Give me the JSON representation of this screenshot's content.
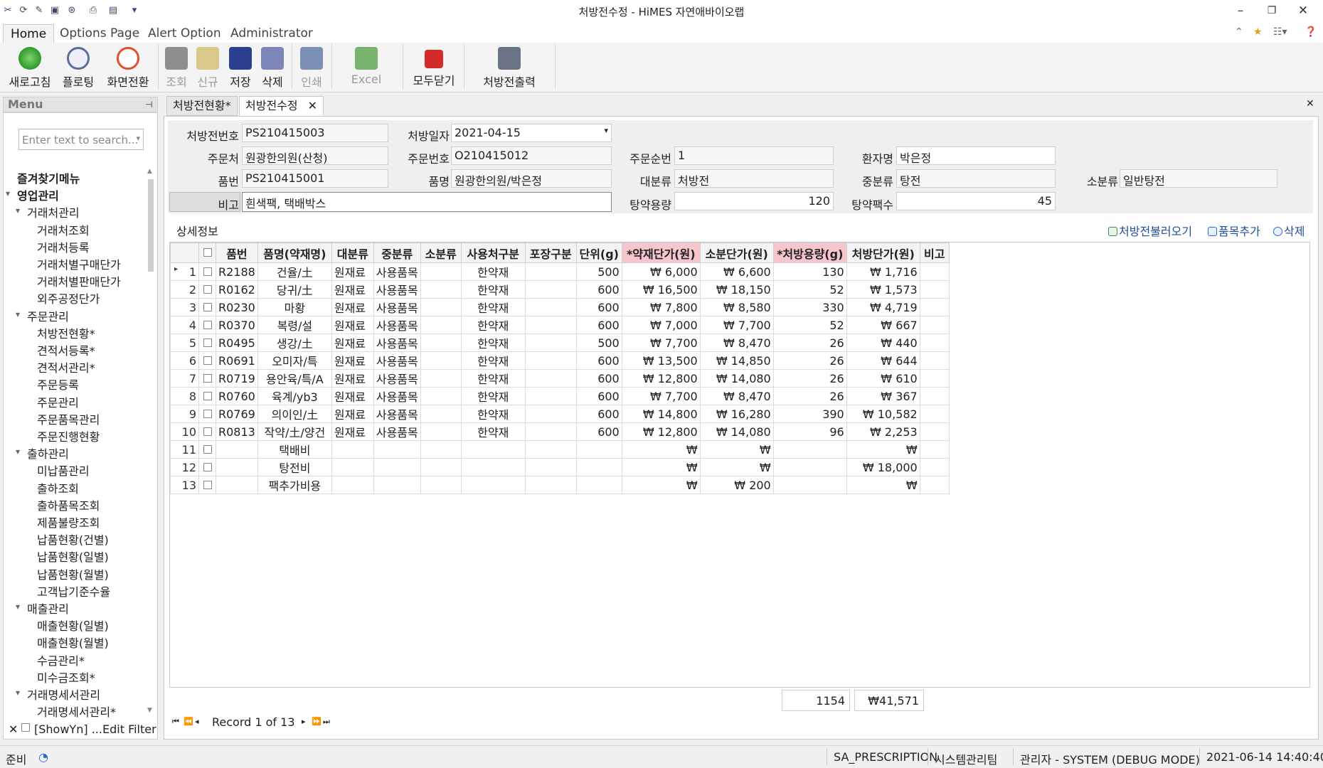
{
  "window": {
    "title": "처방전수정 - HiMES 자연애바이오랩",
    "controls": {
      "minimize": "–",
      "maximize": "❐",
      "close": "✕"
    }
  },
  "ribbon": {
    "tabs": [
      "Home",
      "Options Page",
      "Alert Option",
      "Administrator"
    ],
    "buttons": [
      {
        "label": "새로고침",
        "icon": "refresh-icon",
        "enabled": true
      },
      {
        "label": "플로팅",
        "icon": "floating-icon",
        "enabled": true
      },
      {
        "label": "화면전환",
        "icon": "clock-icon",
        "enabled": true
      },
      {
        "label": "조회",
        "icon": "search-icon",
        "enabled": false
      },
      {
        "label": "신규",
        "icon": "new-icon",
        "enabled": false
      },
      {
        "label": "저장",
        "icon": "save-icon",
        "enabled": true
      },
      {
        "label": "삭제",
        "icon": "delete-icon",
        "enabled": true
      },
      {
        "label": "인쇄",
        "icon": "print-icon",
        "enabled": false
      },
      {
        "label": "Excel",
        "icon": "excel-icon",
        "enabled": false
      },
      {
        "label": "모두닫기",
        "icon": "close-all-icon",
        "enabled": true
      },
      {
        "label": "처방전출력",
        "icon": "printer-icon",
        "enabled": true
      }
    ]
  },
  "menu": {
    "title": "Menu",
    "search_placeholder": "Enter text to search...",
    "items": [
      {
        "label": "즐겨찾기메뉴",
        "level": 0,
        "bold": true
      },
      {
        "label": "영업관리",
        "level": 0,
        "bold": true,
        "toggle": "▾"
      },
      {
        "label": "거래처관리",
        "level": 1,
        "toggle": "▾"
      },
      {
        "label": "거래처조회",
        "level": 2
      },
      {
        "label": "거래처등록",
        "level": 2
      },
      {
        "label": "거래처별구매단가",
        "level": 2
      },
      {
        "label": "거래처별판매단가",
        "level": 2
      },
      {
        "label": "외주공정단가",
        "level": 2
      },
      {
        "label": "주문관리",
        "level": 1,
        "toggle": "▾"
      },
      {
        "label": "처방전현황*",
        "level": 2
      },
      {
        "label": "견적서등록*",
        "level": 2
      },
      {
        "label": "견적서관리*",
        "level": 2
      },
      {
        "label": "주문등록",
        "level": 2
      },
      {
        "label": "주문관리",
        "level": 2
      },
      {
        "label": "주문품목관리",
        "level": 2
      },
      {
        "label": "주문진행현황",
        "level": 2
      },
      {
        "label": "출하관리",
        "level": 1,
        "toggle": "▾"
      },
      {
        "label": "미납품관리",
        "level": 2
      },
      {
        "label": "출하조회",
        "level": 2
      },
      {
        "label": "출하품목조회",
        "level": 2
      },
      {
        "label": "제품불량조회",
        "level": 2
      },
      {
        "label": "납품현황(건별)",
        "level": 2
      },
      {
        "label": "납품현황(일별)",
        "level": 2
      },
      {
        "label": "납품현황(월별)",
        "level": 2
      },
      {
        "label": "고객납기준수율",
        "level": 2
      },
      {
        "label": "매출관리",
        "level": 1,
        "toggle": "▾"
      },
      {
        "label": "매출현황(일별)",
        "level": 2
      },
      {
        "label": "매출현황(월별)",
        "level": 2
      },
      {
        "label": "수금관리*",
        "level": 2
      },
      {
        "label": "미수금조회*",
        "level": 2
      },
      {
        "label": "거래명세서관리",
        "level": 1,
        "toggle": "▾"
      },
      {
        "label": "거래명세서관리*",
        "level": 2
      }
    ],
    "footer": {
      "filter_text": "[ShowYn] ...",
      "edit_filter": "Edit Filter"
    }
  },
  "doc_tabs": [
    {
      "label": "처방전현황*",
      "active": false
    },
    {
      "label": "처방전수정",
      "active": true
    }
  ],
  "form": {
    "prescription_no": {
      "label": "처방전번호",
      "value": "PS210415003"
    },
    "prescription_date": {
      "label": "처방일자",
      "value": "2021-04-15"
    },
    "orderer": {
      "label": "주문처",
      "value": "원광한의원(산청)"
    },
    "order_no": {
      "label": "주문번호",
      "value": "O210415012"
    },
    "order_seq": {
      "label": "주문순번",
      "value": "1"
    },
    "patient": {
      "label": "환자명",
      "value": "박은정"
    },
    "item_no": {
      "label": "품번",
      "value": "PS210415001"
    },
    "item_name": {
      "label": "품명",
      "value": "원광한의원/박은정"
    },
    "major_class": {
      "label": "대분류",
      "value": "처방전"
    },
    "middle_class": {
      "label": "중분류",
      "value": "탕전"
    },
    "minor_class": {
      "label": "소분류",
      "value": "일반탕전"
    },
    "remark": {
      "label": "비고",
      "value": "흰색팩, 택배박스"
    },
    "decoction_volume": {
      "label": "탕약용량",
      "value": "120"
    },
    "pack_count": {
      "label": "탕약팩수",
      "value": "45"
    }
  },
  "detail": {
    "label": "상세정보",
    "actions": [
      "처방전불러오기",
      "품목추가",
      "삭제"
    ],
    "columns": [
      "품번",
      "품명(약재명)",
      "대분류",
      "중분류",
      "소분류",
      "사용처구분",
      "포장구분",
      "단위(g)",
      "*약재단가(원)",
      "소분단가(원)",
      "*처방용량(g)",
      "처방단가(원)",
      "비고"
    ],
    "rows": [
      [
        "1",
        "R2188",
        "건율/土",
        "원재료",
        "사용품목",
        "",
        "한약재",
        "",
        "500",
        "₩ 6,000",
        "₩ 6,600",
        "130",
        "₩ 1,716",
        ""
      ],
      [
        "2",
        "R0162",
        "당귀/土",
        "원재료",
        "사용품목",
        "",
        "한약재",
        "",
        "600",
        "₩ 16,500",
        "₩ 18,150",
        "52",
        "₩ 1,573",
        ""
      ],
      [
        "3",
        "R0230",
        "마황",
        "원재료",
        "사용품목",
        "",
        "한약재",
        "",
        "600",
        "₩ 7,800",
        "₩ 8,580",
        "330",
        "₩ 4,719",
        ""
      ],
      [
        "4",
        "R0370",
        "복령/설",
        "원재료",
        "사용품목",
        "",
        "한약재",
        "",
        "600",
        "₩ 7,000",
        "₩ 7,700",
        "52",
        "₩ 667",
        ""
      ],
      [
        "5",
        "R0495",
        "생강/土",
        "원재료",
        "사용품목",
        "",
        "한약재",
        "",
        "500",
        "₩ 7,700",
        "₩ 8,470",
        "26",
        "₩ 440",
        ""
      ],
      [
        "6",
        "R0691",
        "오미자/특",
        "원재료",
        "사용품목",
        "",
        "한약재",
        "",
        "600",
        "₩ 13,500",
        "₩ 14,850",
        "26",
        "₩ 644",
        ""
      ],
      [
        "7",
        "R0719",
        "용안육/특/A",
        "원재료",
        "사용품목",
        "",
        "한약재",
        "",
        "600",
        "₩ 12,800",
        "₩ 14,080",
        "26",
        "₩ 610",
        ""
      ],
      [
        "8",
        "R0760",
        "육계/yb3",
        "원재료",
        "사용품목",
        "",
        "한약재",
        "",
        "600",
        "₩ 7,700",
        "₩ 8,470",
        "26",
        "₩ 367",
        ""
      ],
      [
        "9",
        "R0769",
        "의이인/土",
        "원재료",
        "사용품목",
        "",
        "한약재",
        "",
        "600",
        "₩ 14,800",
        "₩ 16,280",
        "390",
        "₩ 10,582",
        ""
      ],
      [
        "10",
        "R0813",
        "작약/土/양건",
        "원재료",
        "사용품목",
        "",
        "한약재",
        "",
        "600",
        "₩ 12,800",
        "₩ 14,080",
        "96",
        "₩ 2,253",
        ""
      ],
      [
        "11",
        "",
        "택배비",
        "",
        "",
        "",
        "",
        "",
        "",
        "₩",
        "₩",
        "",
        "₩",
        ""
      ],
      [
        "12",
        "",
        "탕전비",
        "",
        "",
        "",
        "",
        "",
        "",
        "₩",
        "₩",
        "",
        "₩ 18,000",
        ""
      ],
      [
        "13",
        "",
        "팩추가비용",
        "",
        "",
        "",
        "",
        "",
        "",
        "₩",
        "₩ 200",
        "",
        "₩",
        ""
      ]
    ],
    "summary": {
      "total_volume": "1154",
      "total_price": "₩41,571"
    },
    "navigator": {
      "record_text": "Record 1 of 13"
    }
  },
  "status_bar": {
    "ready": "준비",
    "program": "SA_PRESCRIPTION",
    "team": "시스템관리팀",
    "user": "관리자 - SYSTEM (DEBUG MODE)",
    "datetime": "2021-06-14 14:40:40"
  }
}
